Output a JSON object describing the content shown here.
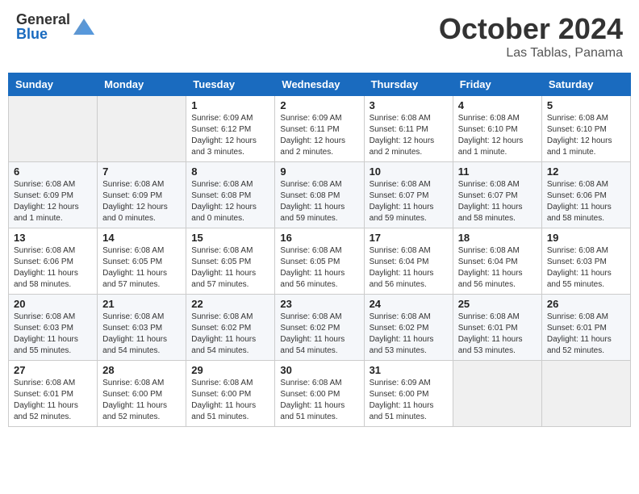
{
  "header": {
    "logo_general": "General",
    "logo_blue": "Blue",
    "month_title": "October 2024",
    "location": "Las Tablas, Panama"
  },
  "days_of_week": [
    "Sunday",
    "Monday",
    "Tuesday",
    "Wednesday",
    "Thursday",
    "Friday",
    "Saturday"
  ],
  "weeks": [
    [
      {
        "day": "",
        "empty": true
      },
      {
        "day": "",
        "empty": true
      },
      {
        "day": "1",
        "sunrise": "Sunrise: 6:09 AM",
        "sunset": "Sunset: 6:12 PM",
        "daylight": "Daylight: 12 hours and 3 minutes."
      },
      {
        "day": "2",
        "sunrise": "Sunrise: 6:09 AM",
        "sunset": "Sunset: 6:11 PM",
        "daylight": "Daylight: 12 hours and 2 minutes."
      },
      {
        "day": "3",
        "sunrise": "Sunrise: 6:08 AM",
        "sunset": "Sunset: 6:11 PM",
        "daylight": "Daylight: 12 hours and 2 minutes."
      },
      {
        "day": "4",
        "sunrise": "Sunrise: 6:08 AM",
        "sunset": "Sunset: 6:10 PM",
        "daylight": "Daylight: 12 hours and 1 minute."
      },
      {
        "day": "5",
        "sunrise": "Sunrise: 6:08 AM",
        "sunset": "Sunset: 6:10 PM",
        "daylight": "Daylight: 12 hours and 1 minute."
      }
    ],
    [
      {
        "day": "6",
        "sunrise": "Sunrise: 6:08 AM",
        "sunset": "Sunset: 6:09 PM",
        "daylight": "Daylight: 12 hours and 1 minute."
      },
      {
        "day": "7",
        "sunrise": "Sunrise: 6:08 AM",
        "sunset": "Sunset: 6:09 PM",
        "daylight": "Daylight: 12 hours and 0 minutes."
      },
      {
        "day": "8",
        "sunrise": "Sunrise: 6:08 AM",
        "sunset": "Sunset: 6:08 PM",
        "daylight": "Daylight: 12 hours and 0 minutes."
      },
      {
        "day": "9",
        "sunrise": "Sunrise: 6:08 AM",
        "sunset": "Sunset: 6:08 PM",
        "daylight": "Daylight: 11 hours and 59 minutes."
      },
      {
        "day": "10",
        "sunrise": "Sunrise: 6:08 AM",
        "sunset": "Sunset: 6:07 PM",
        "daylight": "Daylight: 11 hours and 59 minutes."
      },
      {
        "day": "11",
        "sunrise": "Sunrise: 6:08 AM",
        "sunset": "Sunset: 6:07 PM",
        "daylight": "Daylight: 11 hours and 58 minutes."
      },
      {
        "day": "12",
        "sunrise": "Sunrise: 6:08 AM",
        "sunset": "Sunset: 6:06 PM",
        "daylight": "Daylight: 11 hours and 58 minutes."
      }
    ],
    [
      {
        "day": "13",
        "sunrise": "Sunrise: 6:08 AM",
        "sunset": "Sunset: 6:06 PM",
        "daylight": "Daylight: 11 hours and 58 minutes."
      },
      {
        "day": "14",
        "sunrise": "Sunrise: 6:08 AM",
        "sunset": "Sunset: 6:05 PM",
        "daylight": "Daylight: 11 hours and 57 minutes."
      },
      {
        "day": "15",
        "sunrise": "Sunrise: 6:08 AM",
        "sunset": "Sunset: 6:05 PM",
        "daylight": "Daylight: 11 hours and 57 minutes."
      },
      {
        "day": "16",
        "sunrise": "Sunrise: 6:08 AM",
        "sunset": "Sunset: 6:05 PM",
        "daylight": "Daylight: 11 hours and 56 minutes."
      },
      {
        "day": "17",
        "sunrise": "Sunrise: 6:08 AM",
        "sunset": "Sunset: 6:04 PM",
        "daylight": "Daylight: 11 hours and 56 minutes."
      },
      {
        "day": "18",
        "sunrise": "Sunrise: 6:08 AM",
        "sunset": "Sunset: 6:04 PM",
        "daylight": "Daylight: 11 hours and 56 minutes."
      },
      {
        "day": "19",
        "sunrise": "Sunrise: 6:08 AM",
        "sunset": "Sunset: 6:03 PM",
        "daylight": "Daylight: 11 hours and 55 minutes."
      }
    ],
    [
      {
        "day": "20",
        "sunrise": "Sunrise: 6:08 AM",
        "sunset": "Sunset: 6:03 PM",
        "daylight": "Daylight: 11 hours and 55 minutes."
      },
      {
        "day": "21",
        "sunrise": "Sunrise: 6:08 AM",
        "sunset": "Sunset: 6:03 PM",
        "daylight": "Daylight: 11 hours and 54 minutes."
      },
      {
        "day": "22",
        "sunrise": "Sunrise: 6:08 AM",
        "sunset": "Sunset: 6:02 PM",
        "daylight": "Daylight: 11 hours and 54 minutes."
      },
      {
        "day": "23",
        "sunrise": "Sunrise: 6:08 AM",
        "sunset": "Sunset: 6:02 PM",
        "daylight": "Daylight: 11 hours and 54 minutes."
      },
      {
        "day": "24",
        "sunrise": "Sunrise: 6:08 AM",
        "sunset": "Sunset: 6:02 PM",
        "daylight": "Daylight: 11 hours and 53 minutes."
      },
      {
        "day": "25",
        "sunrise": "Sunrise: 6:08 AM",
        "sunset": "Sunset: 6:01 PM",
        "daylight": "Daylight: 11 hours and 53 minutes."
      },
      {
        "day": "26",
        "sunrise": "Sunrise: 6:08 AM",
        "sunset": "Sunset: 6:01 PM",
        "daylight": "Daylight: 11 hours and 52 minutes."
      }
    ],
    [
      {
        "day": "27",
        "sunrise": "Sunrise: 6:08 AM",
        "sunset": "Sunset: 6:01 PM",
        "daylight": "Daylight: 11 hours and 52 minutes."
      },
      {
        "day": "28",
        "sunrise": "Sunrise: 6:08 AM",
        "sunset": "Sunset: 6:00 PM",
        "daylight": "Daylight: 11 hours and 52 minutes."
      },
      {
        "day": "29",
        "sunrise": "Sunrise: 6:08 AM",
        "sunset": "Sunset: 6:00 PM",
        "daylight": "Daylight: 11 hours and 51 minutes."
      },
      {
        "day": "30",
        "sunrise": "Sunrise: 6:08 AM",
        "sunset": "Sunset: 6:00 PM",
        "daylight": "Daylight: 11 hours and 51 minutes."
      },
      {
        "day": "31",
        "sunrise": "Sunrise: 6:09 AM",
        "sunset": "Sunset: 6:00 PM",
        "daylight": "Daylight: 11 hours and 51 minutes."
      },
      {
        "day": "",
        "empty": true
      },
      {
        "day": "",
        "empty": true
      }
    ]
  ]
}
